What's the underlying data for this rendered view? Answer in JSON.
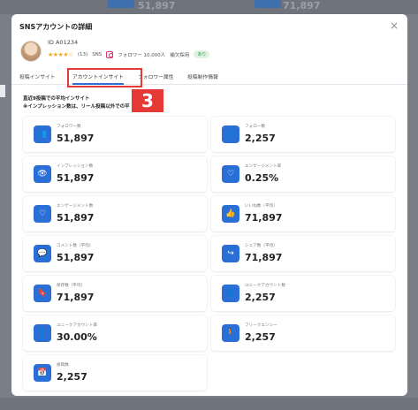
{
  "background": {
    "ghost_values": [
      "51,897",
      "71,897"
    ]
  },
  "modal": {
    "title": "SNSアカウントの詳細",
    "close_icon": "×",
    "user": {
      "id": "ID A01234",
      "stars": "★★★★☆",
      "rating_count": "(13)",
      "sns_label": "SNS",
      "followers": "フォロワー 10,000人",
      "hire_label": "補欠採用",
      "hire_status": "あり"
    },
    "tabs": [
      "投稿インサイト",
      "アカウントインサイト",
      "フォロワー属性",
      "投稿制作情報"
    ],
    "active_tab": 1,
    "annotation_number": "3",
    "note_line1": "直近9投稿での平均インサイト",
    "note_line2": "※インプレッション数は、リール投稿以外での平",
    "metrics": [
      {
        "label": "フォロワー数",
        "value": "51,897",
        "icon": "users-icon",
        "glyph": "👥"
      },
      {
        "label": "フォロー数",
        "value": "2,257",
        "icon": "user-plus-icon",
        "glyph": "👤"
      },
      {
        "label": "インプレッション数",
        "value": "51,897",
        "icon": "eye-icon",
        "glyph": "👁"
      },
      {
        "label": "エンゲージメント率",
        "value": "0.25%",
        "icon": "heart-icon",
        "glyph": "♡"
      },
      {
        "label": "エンゲージメント数",
        "value": "51,897",
        "icon": "heart-icon",
        "glyph": "♡"
      },
      {
        "label": "いいね数（平均）",
        "value": "71,897",
        "icon": "thumbs-up-icon",
        "glyph": "👍"
      },
      {
        "label": "コメント数（平均）",
        "value": "51,897",
        "icon": "comment-icon",
        "glyph": "💬"
      },
      {
        "label": "シェア数（平均）",
        "value": "71,897",
        "icon": "share-icon",
        "glyph": "↪"
      },
      {
        "label": "保存数（平均）",
        "value": "71,897",
        "icon": "bookmark-icon",
        "glyph": "🔖"
      },
      {
        "label": "ユニークアカウント数",
        "value": "2,257",
        "icon": "user-icon",
        "glyph": "👤"
      },
      {
        "label": "ユニークアカウント率",
        "value": "30.00%",
        "icon": "user-icon",
        "glyph": "👤"
      },
      {
        "label": "フリークエンシー",
        "value": "2,257",
        "icon": "person-icon",
        "glyph": "🚶"
      },
      {
        "label": "投稿数",
        "value": "2,257",
        "icon": "calendar-icon",
        "glyph": "📅"
      }
    ]
  },
  "colors": {
    "accent": "#2a6fd6",
    "highlight": "#e53935",
    "star": "#f0a81a"
  }
}
